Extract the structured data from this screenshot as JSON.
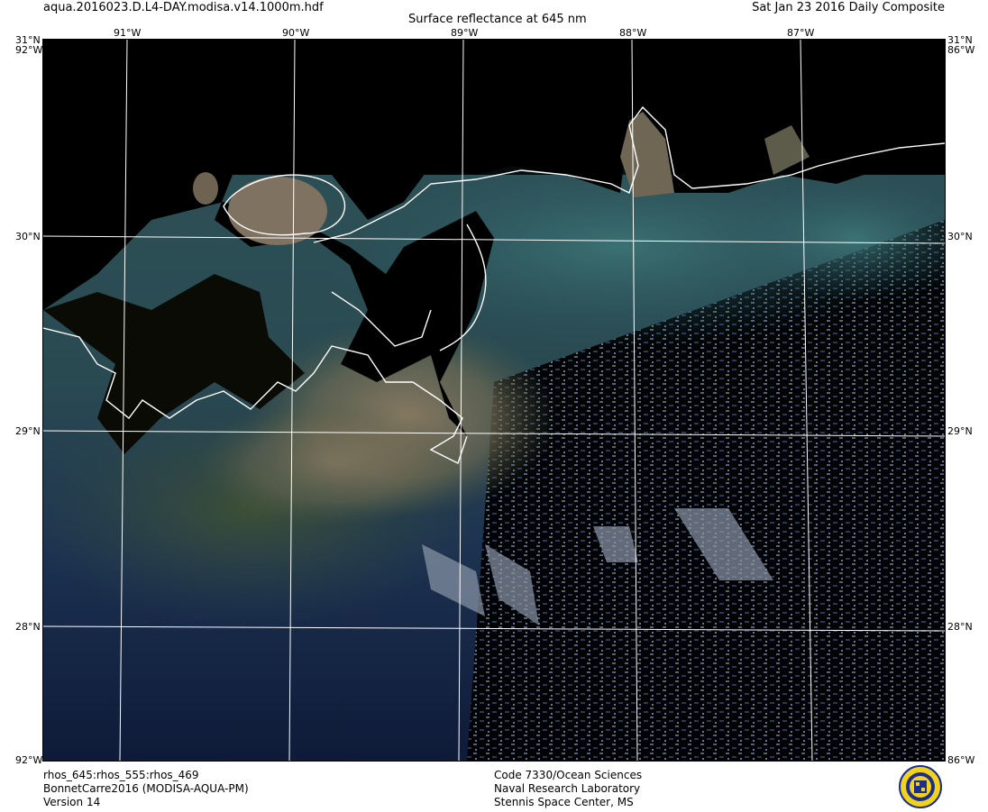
{
  "header": {
    "filename": "aqua.2016023.D.L4-DAY.modisa.v14.1000m.hdf",
    "title": "Surface reflectance at 645 nm",
    "date": "Sat Jan 23 2016 Daily Composite"
  },
  "map": {
    "top_lon_labels": [
      "91°W",
      "90°W",
      "89°W",
      "88°W",
      "87°W"
    ],
    "lat_labels_left": [
      "31°N",
      "30°N",
      "29°N",
      "28°N"
    ],
    "lat_labels_right": [
      "31°N",
      "30°N",
      "29°N",
      "28°N"
    ],
    "corner_labels": {
      "top_left_overlap": "92°W",
      "top_right_overlap": "86°W",
      "bottom_left_overlap": "92°W",
      "bottom_right_overlap": "86°W"
    }
  },
  "footer": {
    "bands": "rhos_645:rhos_555:rhos_469",
    "region": "BonnetCarre2016 (MODISA-AQUA-PM)",
    "version": "Version 14",
    "org_code": "Code 7330/Ocean Sciences",
    "org_name": "Naval Research Laboratory",
    "org_location": "Stennis Space Center, MS"
  },
  "colors": {
    "land": "#000000",
    "sediment_plume": "#8a7b62",
    "turbid_green": "#4b5a3c",
    "shelf_water": "#1e3a55",
    "deep_water": "#0f1c3a",
    "cloud_speckle": "#7d8aa0",
    "coastline": "#ffffff",
    "graticule": "#ffffff"
  },
  "logo": {
    "icon": "nrl-seal-icon"
  }
}
